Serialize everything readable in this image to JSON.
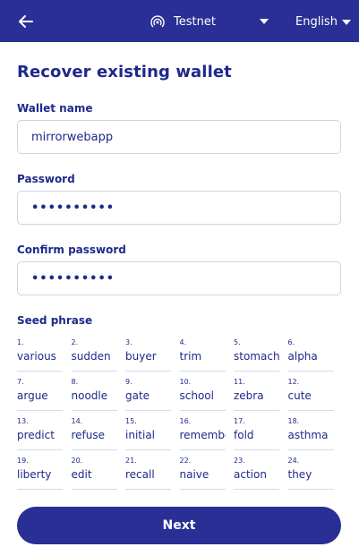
{
  "header": {
    "network_label": "Testnet",
    "language_label": "English",
    "icons": [
      "back-arrow-icon",
      "network-signal-icon",
      "caret-down-icon"
    ]
  },
  "form": {
    "title": "Recover existing wallet",
    "wallet_name": {
      "label": "Wallet name",
      "value": "mirrorwebapp"
    },
    "password": {
      "label": "Password",
      "value": "••••••••••"
    },
    "confirm_password": {
      "label": "Confirm password",
      "value": "••••••••••"
    },
    "seed_phrase": {
      "label": "Seed phrase",
      "words": [
        {
          "n": "1.",
          "w": "various"
        },
        {
          "n": "2.",
          "w": "sudden"
        },
        {
          "n": "3.",
          "w": "buyer"
        },
        {
          "n": "4.",
          "w": "trim"
        },
        {
          "n": "5.",
          "w": "stomach"
        },
        {
          "n": "6.",
          "w": "alpha"
        },
        {
          "n": "7.",
          "w": "argue"
        },
        {
          "n": "8.",
          "w": "noodle"
        },
        {
          "n": "9.",
          "w": "gate"
        },
        {
          "n": "10.",
          "w": "school"
        },
        {
          "n": "11.",
          "w": "zebra"
        },
        {
          "n": "12.",
          "w": "cute"
        },
        {
          "n": "13.",
          "w": "predict"
        },
        {
          "n": "14.",
          "w": "refuse"
        },
        {
          "n": "15.",
          "w": "initial"
        },
        {
          "n": "16.",
          "w": "remember"
        },
        {
          "n": "17.",
          "w": "fold"
        },
        {
          "n": "18.",
          "w": "asthma"
        },
        {
          "n": "19.",
          "w": "liberty"
        },
        {
          "n": "20.",
          "w": "edit"
        },
        {
          "n": "21.",
          "w": "recall"
        },
        {
          "n": "22.",
          "w": "naive"
        },
        {
          "n": "23.",
          "w": "action"
        },
        {
          "n": "24.",
          "w": "they"
        }
      ]
    },
    "next_label": "Next"
  },
  "colors": {
    "primary": "#2a2f96",
    "text": "#1e2a8a",
    "border": "#cfd3e6"
  }
}
